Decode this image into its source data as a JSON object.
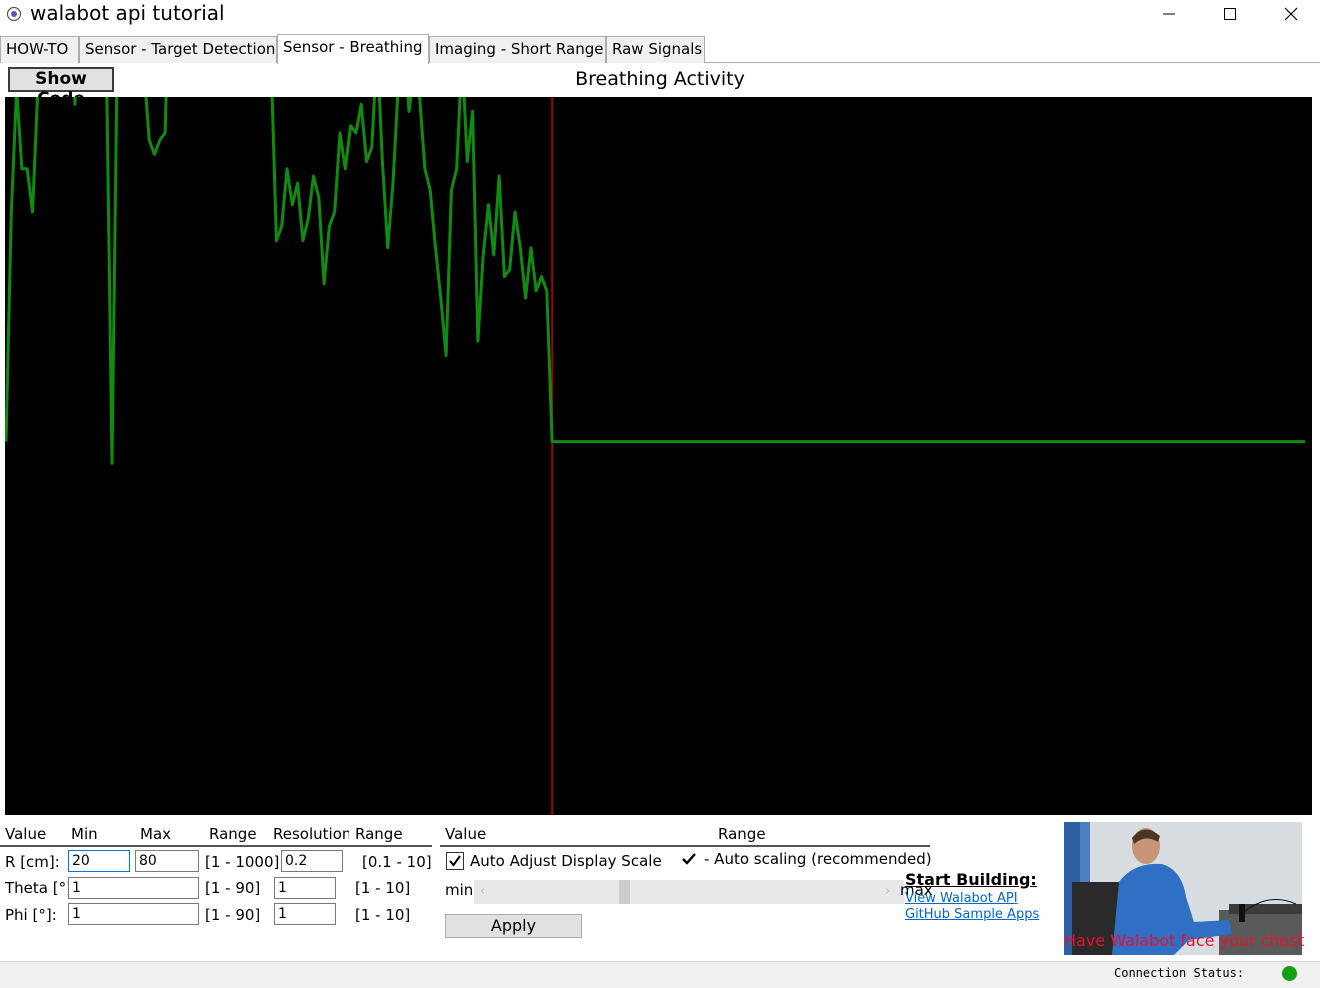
{
  "window": {
    "title": "walabot api tutorial",
    "controls": {
      "minimize_icon": "minimize-icon",
      "maximize_icon": "maximize-icon",
      "close_icon": "close-icon"
    }
  },
  "tabs": [
    {
      "label": "HOW-TO",
      "active": false
    },
    {
      "label": "Sensor - Target Detection",
      "active": false
    },
    {
      "label": "Sensor - Breathing",
      "active": true
    },
    {
      "label": "Imaging - Short Range",
      "active": false
    },
    {
      "label": "Raw Signals",
      "active": false
    }
  ],
  "toolbar": {
    "show_code_label": "Show Code"
  },
  "chart_data": {
    "type": "line",
    "title": "Breathing Activity",
    "line_color": "#118c11",
    "marker_color": "#cc0000",
    "background": "#000000",
    "grid": false,
    "ylim": [
      0,
      100
    ],
    "marker_index": 103,
    "series": [
      {
        "values": [
          52,
          84,
          101,
          90,
          90,
          84,
          101,
          106,
          124,
          116,
          113,
          118,
          129,
          99,
          120,
          123,
          124,
          107,
          104,
          102,
          49,
          107,
          121,
          118,
          119,
          118,
          104,
          94,
          92,
          94,
          95,
          122,
          132,
          135,
          118,
          112,
          117,
          121,
          115,
          114,
          104,
          106,
          118,
          117,
          120,
          123,
          109,
          129,
          118,
          109,
          105,
          80,
          82,
          90,
          85,
          88,
          80,
          83,
          89,
          86,
          74,
          82,
          84,
          95,
          90,
          96,
          95,
          99,
          91,
          93,
          107,
          91,
          79,
          88,
          102,
          111,
          98,
          104,
          100,
          90,
          87,
          79,
          72,
          64,
          87,
          90,
          106,
          91,
          98,
          66,
          78,
          85,
          78,
          89,
          75,
          76,
          84,
          79,
          72,
          79,
          73,
          75,
          73,
          52,
          52
        ]
      }
    ]
  },
  "arena": {
    "headers": {
      "value": "Value",
      "min": "Min",
      "max": "Max",
      "range": "Range",
      "resolution": "Resolution",
      "res_range": "Range"
    },
    "rows": [
      {
        "label": "R [cm]:",
        "min": "20",
        "max": "80",
        "range": "[1 - 1000]",
        "resolution": "0.2",
        "res_range": "[0.1 - 10]"
      },
      {
        "label": "Theta [°]:",
        "max": "1",
        "range": "[1 - 90]",
        "resolution": "1",
        "res_range": "[1 - 10]"
      },
      {
        "label": "Phi [°]:",
        "max": "1",
        "range": "[1 - 90]",
        "resolution": "1",
        "res_range": "[1 - 10]"
      }
    ]
  },
  "display": {
    "header_value": "Value",
    "header_range": "Range",
    "auto_adjust_label": "Auto Adjust Display Scale",
    "auto_adjust_checked": true,
    "auto_scaling_note": "- Auto scaling (recommended)",
    "min_label": "min",
    "max_label": "max",
    "apply_label": "Apply"
  },
  "links": {
    "heading": "Start Building:",
    "api": "View Walabot API",
    "github": "GitHub Sample Apps"
  },
  "photo": {
    "caption": "Have Walabot face your chest"
  },
  "status": {
    "label": "Connection Status:",
    "connected": true,
    "color": "#12a012"
  }
}
